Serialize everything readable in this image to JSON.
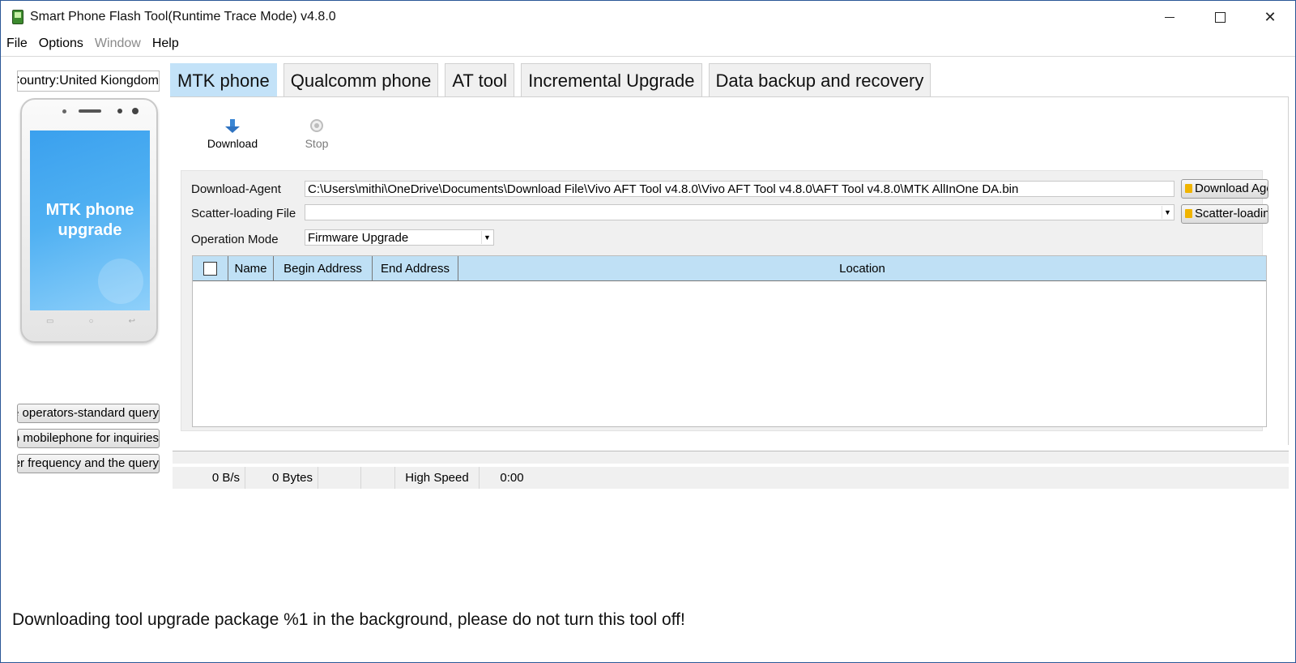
{
  "window": {
    "title": "Smart Phone Flash Tool(Runtime Trace Mode)  v4.8.0",
    "minimize_glyph": "—",
    "maximize_glyph": "☐",
    "close_glyph": "✕"
  },
  "menu": [
    {
      "label": "File",
      "disabled": false
    },
    {
      "label": "Options",
      "disabled": false
    },
    {
      "label": "Window",
      "disabled": true
    },
    {
      "label": "Help",
      "disabled": false
    }
  ],
  "sidebar": {
    "country": "Country:United Kiongdom",
    "phone_screen_line1": "MTK phone",
    "phone_screen_line2": "upgrade",
    "buttons": [
      "Mobile operators-standard query",
      "Vivo mobilephone for inquiries",
      "Carrier frequency and the query"
    ]
  },
  "tabs": [
    {
      "label": "MTK phone",
      "active": true
    },
    {
      "label": "Qualcomm phone",
      "active": false
    },
    {
      "label": "AT tool",
      "active": false
    },
    {
      "label": "Incremental Upgrade",
      "active": false
    },
    {
      "label": "Data backup and recovery",
      "active": false
    }
  ],
  "toolbar": {
    "download_label": "Download",
    "stop_label": "Stop"
  },
  "form": {
    "download_agent_label": "Download-Agent",
    "download_agent_value": "C:\\Users\\mithi\\OneDrive\\Documents\\Download File\\Vivo  AFT  Tool  v4.8.0\\Vivo  AFT  Tool  v4.8.0\\AFT  Tool  v4.8.0\\MTK  AllInOne  DA.bin",
    "download_agent_button": "Download Agent",
    "scatter_label": "Scatter-loading File",
    "scatter_value": "",
    "scatter_button": "Scatter-loading",
    "operation_mode_label": "Operation Mode",
    "operation_mode_value": "Firmware Upgrade"
  },
  "table": {
    "columns": [
      "",
      "Name",
      "Begin Address",
      "End Address",
      "Location"
    ],
    "rows": []
  },
  "status": {
    "speed": "0 B/s",
    "bytes": "0 Bytes",
    "cell3": "",
    "cell4": "",
    "mode": "High Speed",
    "time": "0:00"
  },
  "footer_message": "Downloading tool upgrade package %1 in the background, please do not turn this tool off!",
  "colors": {
    "active_tab": "#c3e2f8",
    "table_header": "#bfe0f5",
    "download_icon": "#3a86d4"
  }
}
